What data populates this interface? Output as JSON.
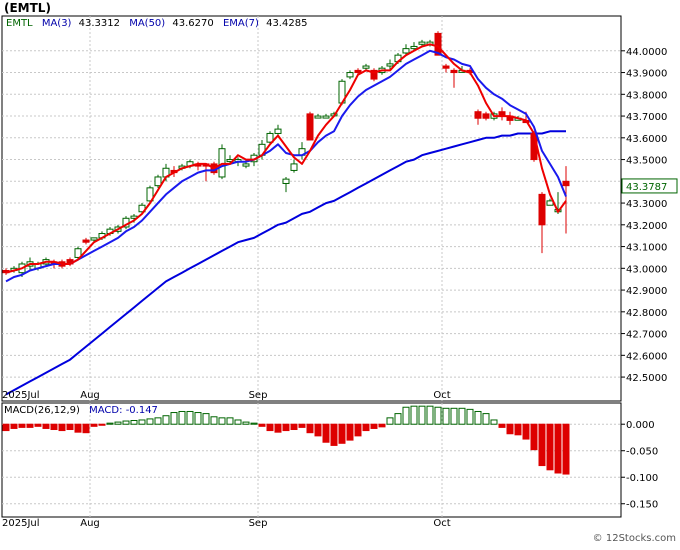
{
  "title": "(EMTL)",
  "credit": "© 12Stocks.com",
  "colors": {
    "background": "#ffffff",
    "grid": "#c8c8c8",
    "axis": "#000000",
    "up_candle_fill": "#ffffff",
    "up_candle_border": "#006400",
    "down_candle": "#dd0000",
    "ma3": "#ee0000",
    "ma50": "#0000dd",
    "ema7": "#1a1aee",
    "macd_pos": "#006400",
    "macd_neg": "#dd0000",
    "legend_text": "#0000aa",
    "symbol_text": "#006400"
  },
  "chart_data": [
    {
      "type": "candlestick",
      "symbol": "EMTL",
      "legend": [
        {
          "key": "symbol",
          "label": "EMTL",
          "value": ""
        },
        {
          "key": "ma3",
          "label": "MA(3)",
          "value": "43.3312"
        },
        {
          "key": "ma50",
          "label": "MA(50)",
          "value": "43.6270"
        },
        {
          "key": "ema7",
          "label": "EMA(7)",
          "value": "43.4285"
        }
      ],
      "last_price_label": "43.3787",
      "y_ticks": [
        "44.0000",
        "43.9000",
        "43.8000",
        "43.7000",
        "43.6000",
        "43.5000",
        "43.4000",
        "43.3000",
        "43.2000",
        "43.1000",
        "43.0000",
        "42.9000",
        "42.8000",
        "42.7000",
        "42.6000",
        "42.5000"
      ],
      "ylim": [
        42.39,
        44.16
      ],
      "x_labels": [
        {
          "label": "2025Jul",
          "index": 0
        },
        {
          "label": "Aug",
          "index": 11
        },
        {
          "label": "Sep",
          "index": 32
        },
        {
          "label": "Oct",
          "index": 55
        }
      ],
      "n_slots": 72,
      "candles": [
        {
          "o": 42.99,
          "h": 43.0,
          "l": 42.97,
          "c": 42.98
        },
        {
          "o": 42.99,
          "h": 43.01,
          "l": 42.98,
          "c": 43.0
        },
        {
          "o": 42.98,
          "h": 43.03,
          "l": 42.96,
          "c": 43.02
        },
        {
          "o": 43.01,
          "h": 43.05,
          "l": 42.99,
          "c": 43.03
        },
        {
          "o": 43.0,
          "h": 43.03,
          "l": 42.99,
          "c": 43.02
        },
        {
          "o": 43.02,
          "h": 43.05,
          "l": 43.01,
          "c": 43.04
        },
        {
          "o": 43.03,
          "h": 43.04,
          "l": 43.0,
          "c": 43.02
        },
        {
          "o": 43.03,
          "h": 43.04,
          "l": 43.0,
          "c": 43.01
        },
        {
          "o": 43.04,
          "h": 43.05,
          "l": 43.01,
          "c": 43.02
        },
        {
          "o": 43.05,
          "h": 43.1,
          "l": 43.04,
          "c": 43.09
        },
        {
          "o": 43.13,
          "h": 43.14,
          "l": 43.11,
          "c": 43.12
        },
        {
          "o": 43.13,
          "h": 43.14,
          "l": 43.12,
          "c": 43.14
        },
        {
          "o": 43.14,
          "h": 43.17,
          "l": 43.13,
          "c": 43.16
        },
        {
          "o": 43.16,
          "h": 43.19,
          "l": 43.15,
          "c": 43.18
        },
        {
          "o": 43.17,
          "h": 43.2,
          "l": 43.16,
          "c": 43.19
        },
        {
          "o": 43.19,
          "h": 43.24,
          "l": 43.18,
          "c": 43.23
        },
        {
          "o": 43.23,
          "h": 43.25,
          "l": 43.21,
          "c": 43.24
        },
        {
          "o": 43.26,
          "h": 43.3,
          "l": 43.25,
          "c": 43.29
        },
        {
          "o": 43.31,
          "h": 43.38,
          "l": 43.3,
          "c": 43.37
        },
        {
          "o": 43.38,
          "h": 43.43,
          "l": 43.37,
          "c": 43.42
        },
        {
          "o": 43.42,
          "h": 43.48,
          "l": 43.4,
          "c": 43.46
        },
        {
          "o": 43.45,
          "h": 43.47,
          "l": 43.42,
          "c": 43.44
        },
        {
          "o": 43.46,
          "h": 43.48,
          "l": 43.45,
          "c": 43.47
        },
        {
          "o": 43.47,
          "h": 43.5,
          "l": 43.46,
          "c": 43.49
        },
        {
          "o": 43.48,
          "h": 43.49,
          "l": 43.45,
          "c": 43.47
        },
        {
          "o": 43.48,
          "h": 43.48,
          "l": 43.4,
          "c": 43.47
        },
        {
          "o": 43.48,
          "h": 43.49,
          "l": 43.43,
          "c": 43.44
        },
        {
          "o": 43.42,
          "h": 43.57,
          "l": 43.41,
          "c": 43.55
        },
        {
          "o": 43.5,
          "h": 43.52,
          "l": 43.48,
          "c": 43.5
        },
        {
          "o": 43.49,
          "h": 43.51,
          "l": 43.47,
          "c": 43.5
        },
        {
          "o": 43.47,
          "h": 43.5,
          "l": 43.46,
          "c": 43.48
        },
        {
          "o": 43.49,
          "h": 43.53,
          "l": 43.47,
          "c": 43.52
        },
        {
          "o": 43.52,
          "h": 43.59,
          "l": 43.5,
          "c": 43.57
        },
        {
          "o": 43.58,
          "h": 43.63,
          "l": 43.57,
          "c": 43.62
        },
        {
          "o": 43.62,
          "h": 43.66,
          "l": 43.61,
          "c": 43.64
        },
        {
          "o": 43.39,
          "h": 43.42,
          "l": 43.35,
          "c": 43.41
        },
        {
          "o": 43.45,
          "h": 43.5,
          "l": 43.44,
          "c": 43.48
        },
        {
          "o": 43.52,
          "h": 43.58,
          "l": 43.5,
          "c": 43.55
        },
        {
          "o": 43.71,
          "h": 43.72,
          "l": 43.59,
          "c": 43.59
        },
        {
          "o": 43.7,
          "h": 43.71,
          "l": 43.69,
          "c": 43.7
        },
        {
          "o": 43.7,
          "h": 43.71,
          "l": 43.69,
          "c": 43.7
        },
        {
          "o": 43.71,
          "h": 43.72,
          "l": 43.7,
          "c": 43.71
        },
        {
          "o": 43.76,
          "h": 43.87,
          "l": 43.75,
          "c": 43.86
        },
        {
          "o": 43.88,
          "h": 43.91,
          "l": 43.87,
          "c": 43.9
        },
        {
          "o": 43.91,
          "h": 43.92,
          "l": 43.89,
          "c": 43.9
        },
        {
          "o": 43.92,
          "h": 43.94,
          "l": 43.91,
          "c": 43.93
        },
        {
          "o": 43.91,
          "h": 43.92,
          "l": 43.86,
          "c": 43.87
        },
        {
          "o": 43.9,
          "h": 43.93,
          "l": 43.89,
          "c": 43.92
        },
        {
          "o": 43.93,
          "h": 43.96,
          "l": 43.91,
          "c": 43.94
        },
        {
          "o": 43.95,
          "h": 43.99,
          "l": 43.94,
          "c": 43.98
        },
        {
          "o": 43.99,
          "h": 44.03,
          "l": 43.98,
          "c": 44.01
        },
        {
          "o": 44.01,
          "h": 44.04,
          "l": 44.0,
          "c": 44.02
        },
        {
          "o": 44.03,
          "h": 44.05,
          "l": 44.02,
          "c": 44.04
        },
        {
          "o": 44.03,
          "h": 44.05,
          "l": 44.02,
          "c": 44.04
        },
        {
          "o": 44.08,
          "h": 44.09,
          "l": 43.98,
          "c": 43.98
        },
        {
          "o": 43.93,
          "h": 43.94,
          "l": 43.9,
          "c": 43.92
        },
        {
          "o": 43.91,
          "h": 43.92,
          "l": 43.83,
          "c": 43.9
        },
        {
          "o": 43.91,
          "h": 43.93,
          "l": 43.9,
          "c": 43.91
        },
        {
          "o": 43.91,
          "h": 43.92,
          "l": 43.89,
          "c": 43.9
        },
        {
          "o": 43.72,
          "h": 43.73,
          "l": 43.66,
          "c": 43.69
        },
        {
          "o": 43.71,
          "h": 43.72,
          "l": 43.68,
          "c": 43.69
        },
        {
          "o": 43.69,
          "h": 43.72,
          "l": 43.68,
          "c": 43.71
        },
        {
          "o": 43.72,
          "h": 43.74,
          "l": 43.68,
          "c": 43.7
        },
        {
          "o": 43.7,
          "h": 43.72,
          "l": 43.66,
          "c": 43.68
        },
        {
          "o": 43.69,
          "h": 43.7,
          "l": 43.68,
          "c": 43.69
        },
        {
          "o": 43.68,
          "h": 43.72,
          "l": 43.67,
          "c": 43.67
        },
        {
          "o": 43.62,
          "h": 43.63,
          "l": 43.49,
          "c": 43.5
        },
        {
          "o": 43.34,
          "h": 43.35,
          "l": 43.07,
          "c": 43.2
        },
        {
          "o": 43.29,
          "h": 43.32,
          "l": 43.29,
          "c": 43.31
        },
        {
          "o": 43.26,
          "h": 43.35,
          "l": 43.25,
          "c": 43.27
        },
        {
          "o": 43.4,
          "h": 43.47,
          "l": 43.16,
          "c": 43.38
        }
      ],
      "ma3": [
        42.98,
        42.99,
        43.0,
        43.02,
        43.02,
        43.03,
        43.03,
        43.02,
        43.02,
        43.04,
        43.08,
        43.12,
        43.14,
        43.16,
        43.18,
        43.2,
        43.22,
        43.25,
        43.3,
        43.36,
        43.42,
        43.44,
        43.46,
        43.47,
        43.48,
        43.48,
        43.46,
        43.48,
        43.48,
        43.52,
        43.5,
        43.5,
        43.52,
        43.57,
        43.61,
        43.56,
        43.51,
        43.48,
        43.54,
        43.61,
        43.66,
        43.7,
        43.76,
        43.82,
        43.89,
        43.91,
        43.9,
        43.91,
        43.91,
        43.95,
        43.98,
        44.0,
        44.02,
        44.03,
        44.02,
        43.98,
        43.94,
        43.91,
        43.9,
        43.84,
        43.76,
        43.7,
        43.7,
        43.7,
        43.69,
        43.68,
        43.62,
        43.46,
        43.34,
        43.26,
        43.31
      ],
      "ema7": [
        42.94,
        42.96,
        42.97,
        42.99,
        43.0,
        43.01,
        43.02,
        43.02,
        43.02,
        43.04,
        43.06,
        43.08,
        43.1,
        43.12,
        43.14,
        43.17,
        43.19,
        43.22,
        43.26,
        43.3,
        43.34,
        43.37,
        43.4,
        43.42,
        43.44,
        43.45,
        43.45,
        43.47,
        43.48,
        43.49,
        43.49,
        43.5,
        43.52,
        43.54,
        43.57,
        43.53,
        43.52,
        43.52,
        43.54,
        43.58,
        43.61,
        43.63,
        43.7,
        43.75,
        43.79,
        43.82,
        43.84,
        43.86,
        43.88,
        43.91,
        43.94,
        43.96,
        43.98,
        44.0,
        43.99,
        43.97,
        43.96,
        43.94,
        43.93,
        43.87,
        43.83,
        43.8,
        43.78,
        43.75,
        43.73,
        43.71,
        43.65,
        43.54,
        43.48,
        43.42,
        43.33
      ],
      "ma50": [
        42.42,
        42.44,
        42.46,
        42.48,
        42.5,
        42.52,
        42.54,
        42.56,
        42.58,
        42.61,
        42.64,
        42.67,
        42.7,
        42.73,
        42.76,
        42.79,
        42.82,
        42.85,
        42.88,
        42.91,
        42.94,
        42.96,
        42.98,
        43.0,
        43.02,
        43.04,
        43.06,
        43.08,
        43.1,
        43.12,
        43.13,
        43.14,
        43.16,
        43.18,
        43.2,
        43.21,
        43.23,
        43.25,
        43.26,
        43.28,
        43.3,
        43.31,
        43.33,
        43.35,
        43.37,
        43.39,
        43.41,
        43.43,
        43.45,
        43.47,
        43.49,
        43.5,
        43.52,
        43.53,
        43.54,
        43.55,
        43.56,
        43.57,
        43.58,
        43.59,
        43.6,
        43.6,
        43.61,
        43.61,
        43.62,
        43.62,
        43.62,
        43.62,
        43.63,
        43.63,
        43.63
      ]
    },
    {
      "type": "bar",
      "name": "MACD",
      "legend": [
        {
          "key": "macd_params",
          "label": "MACD(26,12,9)",
          "value": ""
        },
        {
          "key": "macd_value",
          "label": "MACD:",
          "value": "-0.147"
        }
      ],
      "y_ticks": [
        "0.000",
        "-0.050",
        "-0.100",
        "-0.150"
      ],
      "ylim": [
        -0.175,
        0.04
      ],
      "values": [
        -0.012,
        -0.008,
        -0.006,
        -0.006,
        -0.004,
        -0.008,
        -0.01,
        -0.012,
        -0.01,
        -0.015,
        -0.016,
        -0.004,
        -0.002,
        0.002,
        0.004,
        0.006,
        0.007,
        0.008,
        0.01,
        0.012,
        0.016,
        0.022,
        0.024,
        0.024,
        0.022,
        0.02,
        0.014,
        0.012,
        0.012,
        0.008,
        0.004,
        0.002,
        -0.004,
        -0.012,
        -0.015,
        -0.012,
        -0.01,
        -0.006,
        -0.016,
        -0.022,
        -0.034,
        -0.04,
        -0.036,
        -0.03,
        -0.022,
        -0.012,
        -0.008,
        -0.005,
        0.012,
        0.02,
        0.032,
        0.034,
        0.034,
        0.034,
        0.032,
        0.03,
        0.03,
        0.03,
        0.028,
        0.024,
        0.02,
        0.008,
        -0.006,
        -0.018,
        -0.02,
        -0.028,
        -0.048,
        -0.078,
        -0.086,
        -0.092,
        -0.094
      ]
    }
  ]
}
